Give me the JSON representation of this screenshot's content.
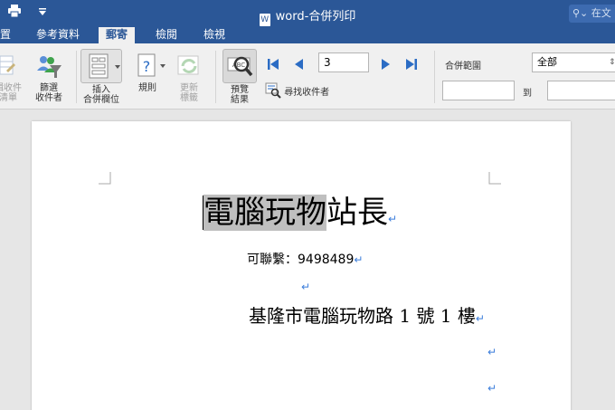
{
  "window": {
    "title": "word-合併列印",
    "search_placeholder": "在文"
  },
  "tabs": [
    {
      "label": "置"
    },
    {
      "label": "參考資料"
    },
    {
      "label": "郵寄"
    },
    {
      "label": "檢閱"
    },
    {
      "label": "檢視"
    }
  ],
  "ribbon": {
    "edit_list_label": "編輯收件\n者清單",
    "filter_label": "篩選\n收件者",
    "insert_field_label": "插入\n合併欄位",
    "rules_label": "規則",
    "update_labels_label": "更新\n標籤",
    "preview_label": "預覽\n結果",
    "find_recipient_label": "尋找收件者",
    "record_number": "3",
    "merge_range_label": "合併範圍",
    "merge_range_value": "全部",
    "to_label": "到"
  },
  "document": {
    "name_highlighted": "電腦玩物",
    "name_rest": "站長",
    "phone_line": "可聯繫：9498489",
    "address_line": "基隆市電腦玩物路 1 號 1 樓",
    "paragraph_mark": "↵"
  },
  "colors": {
    "title_bar": "#2b5797",
    "ribbon": "#f0f0f0",
    "paragraph_mark": "#3b7ddb"
  }
}
